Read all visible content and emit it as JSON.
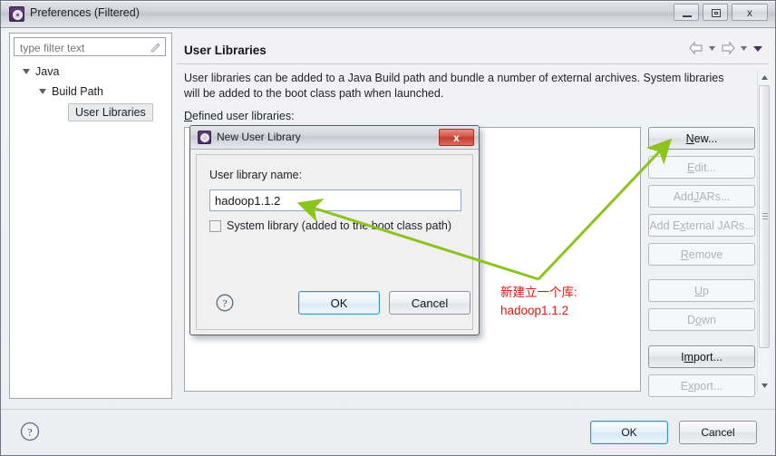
{
  "window": {
    "title": "Preferences (Filtered)",
    "icon": "eclipse-gear-icon",
    "minimize_label": "Minimize",
    "maximize_label": "Maximize",
    "close_label": "x"
  },
  "sidebar": {
    "filter": {
      "value": "",
      "placeholder": "type filter text",
      "clear_icon": "clear-filter-icon"
    },
    "tree": [
      {
        "label": "Java",
        "level": 0,
        "expanded": true,
        "selected": false
      },
      {
        "label": "Build Path",
        "level": 1,
        "expanded": true,
        "selected": false
      },
      {
        "label": "User Libraries",
        "level": 2,
        "expanded": false,
        "selected": true
      }
    ]
  },
  "main": {
    "page_title": "User Libraries",
    "description": "User libraries can be added to a Java Build path and bundle a number of external archives. System libraries will be added to the boot class path when launched.",
    "defined_label_accel": "D",
    "defined_label_rest": "efined user libraries:",
    "nav": {
      "back_icon": "arrow-left-icon",
      "back_menu_icon": "chevron-down-icon",
      "forward_icon": "arrow-right-icon",
      "forward_menu_icon": "chevron-down-icon",
      "view_menu_icon": "triangle-down-icon"
    },
    "buttons": [
      {
        "accel": "N",
        "rest": "ew...",
        "enabled": true,
        "name": "new-button"
      },
      {
        "accel": "E",
        "rest": "dit...",
        "enabled": false,
        "name": "edit-button"
      },
      {
        "pre": "Add ",
        "accel": "J",
        "rest": "ARs...",
        "enabled": false,
        "name": "add-jars-button"
      },
      {
        "pre": "Add E",
        "accel": "x",
        "rest": "ternal JARs...",
        "enabled": false,
        "name": "add-external-jars-button"
      },
      {
        "accel": "R",
        "rest": "emove",
        "enabled": false,
        "name": "remove-button"
      },
      {
        "accel": "U",
        "rest": "p",
        "enabled": false,
        "name": "up-button"
      },
      {
        "pre": "D",
        "accel": "o",
        "rest": "wn",
        "enabled": false,
        "name": "down-button"
      },
      {
        "pre": "I",
        "accel": "m",
        "rest": "port...",
        "enabled": true,
        "name": "import-button"
      },
      {
        "pre": "E",
        "accel": "x",
        "rest": "port...",
        "enabled": false,
        "name": "export-button"
      }
    ],
    "scrollbar": {
      "up_icon": "scroll-up-icon",
      "down_icon": "scroll-down-icon",
      "thumb_grip_icon": "grip-icon"
    }
  },
  "footer": {
    "help_icon": "help-question-icon",
    "ok_label": "OK",
    "cancel_label": "Cancel"
  },
  "dialog": {
    "title": "New User Library",
    "icon": "eclipse-gear-icon",
    "close_label": "x",
    "name_label": "User library name:",
    "name_value": "hadoop1.1.2",
    "system_library_label": "System library (added to the boot class path)",
    "system_library_checked": false,
    "help_icon": "help-question-icon",
    "ok_label": "OK",
    "cancel_label": "Cancel"
  },
  "annotation": {
    "line1": "新建立一个库:",
    "line2": "hadoop1.1.2",
    "text_color": "#e8140a",
    "arrow_color": "#8cc41e"
  }
}
